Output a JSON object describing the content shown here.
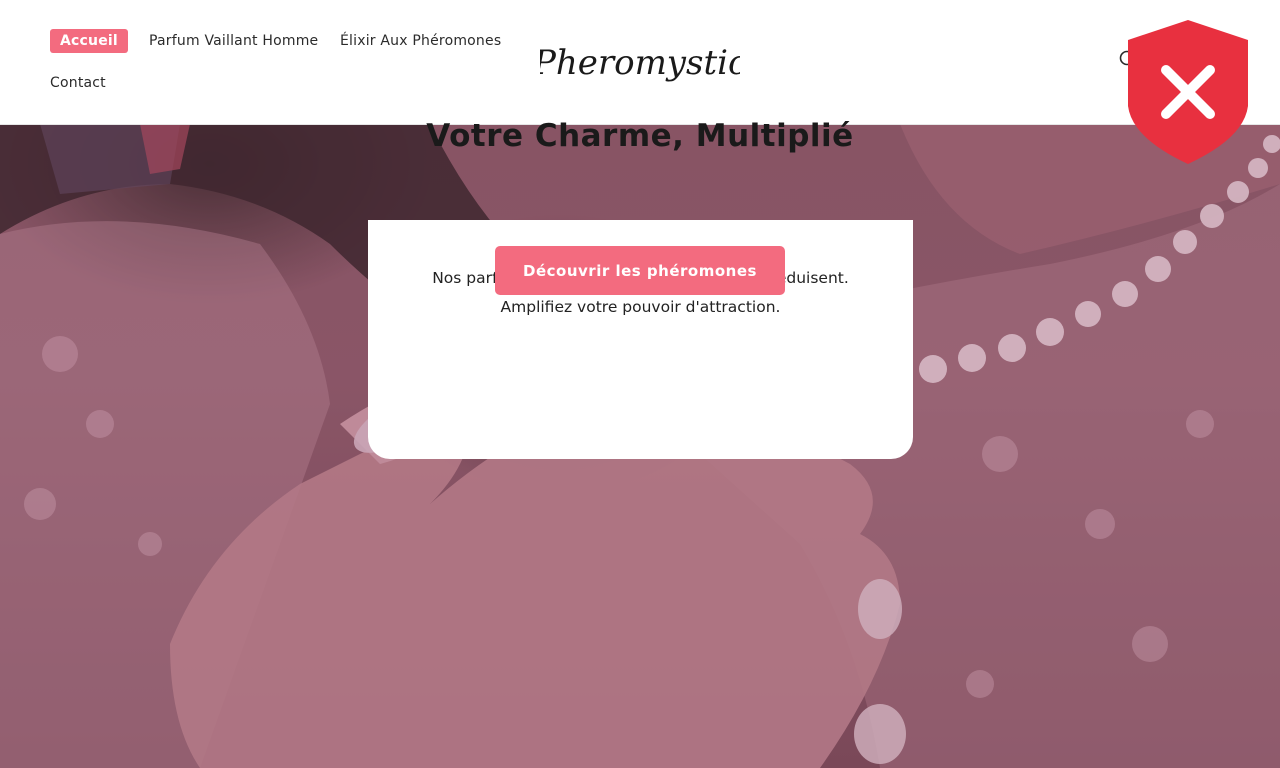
{
  "nav": {
    "items": [
      {
        "label": "Accueil",
        "active": true
      },
      {
        "label": "Parfum Vaillant Homme",
        "active": false
      },
      {
        "label": "Élixir Aux Phéromones",
        "active": false
      },
      {
        "label": "Contact",
        "active": false
      }
    ]
  },
  "brand": {
    "logo_text": "Pheromystic"
  },
  "hero": {
    "title": "Votre Charme, Multiplié",
    "subtitle_line1": "Nos parfums aux phéromones captivent et séduisent.",
    "subtitle_line2": "Amplifiez votre pouvoir d'attraction.",
    "cta_label": "Découvrir les phéromones"
  },
  "icons": {
    "search": "search-icon",
    "security_badge": "shield-x-icon"
  },
  "colors": {
    "accent": "#f36b7f",
    "badge_red": "#e8303f",
    "hero_overlay": "#8c5b69"
  }
}
